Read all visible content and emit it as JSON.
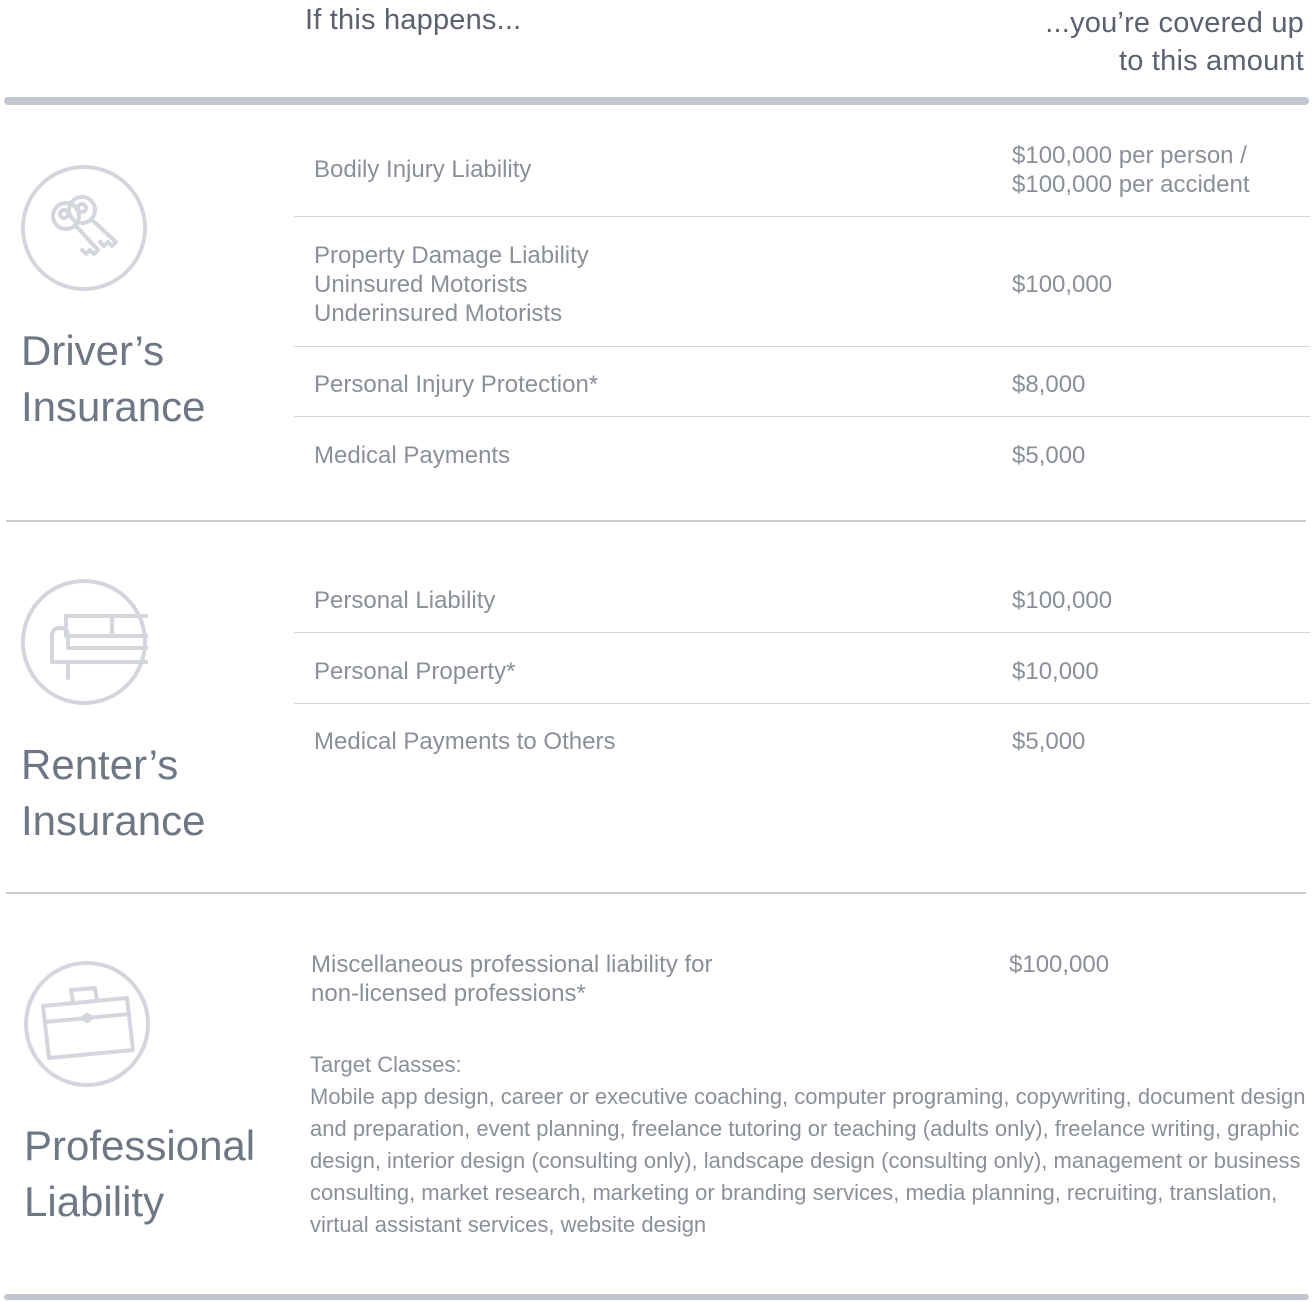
{
  "header": {
    "left": "If this happens...",
    "right_line1": "...you’re covered up",
    "right_line2": "to this amount"
  },
  "drivers": {
    "title_line1": "Driver’s",
    "title_line2": "Insurance",
    "icon": "keys-icon",
    "rows": [
      {
        "items": [
          "Bodily Injury Liability"
        ],
        "value_lines": [
          "$100,000 per person /",
          "$100,000 per accident"
        ]
      },
      {
        "items": [
          "Property Damage Liability",
          "Uninsured Motorists",
          "Underinsured Motorists"
        ],
        "value_lines": [
          "$100,000"
        ]
      },
      {
        "items": [
          "Personal Injury Protection*"
        ],
        "value_lines": [
          "$8,000"
        ]
      },
      {
        "items": [
          "Medical Payments"
        ],
        "value_lines": [
          "$5,000"
        ]
      }
    ]
  },
  "renters": {
    "title_line1": "Renter’s",
    "title_line2": "Insurance",
    "icon": "couch-icon",
    "rows": [
      {
        "item": "Personal Liability",
        "value": "$100,000"
      },
      {
        "item": "Personal Property*",
        "value": "$10,000"
      },
      {
        "item": "Medical Payments to Others",
        "value": "$5,000"
      }
    ]
  },
  "professional": {
    "title_line1": "Professional",
    "title_line2": "Liability",
    "icon": "briefcase-icon",
    "item_line1": "Miscellaneous professional liability for",
    "item_line2": "non-licensed professions*",
    "value": "$100,000",
    "classes_label": "Target Classes:",
    "classes_text": "Mobile app design, career or executive coaching, computer programing, copywriting, document design and preparation, event planning, freelance tutoring or teaching (adults only), freelance writing, graphic design, interior design (consulting only), landscape design (consulting only), management or business consulting, market research, marketing or branding services, media planning, recruiting, translation, virtual assistant services, website design"
  },
  "colors": {
    "text": "#8a9099",
    "heading": "#6f7785",
    "rule": "#c2c7cf"
  }
}
